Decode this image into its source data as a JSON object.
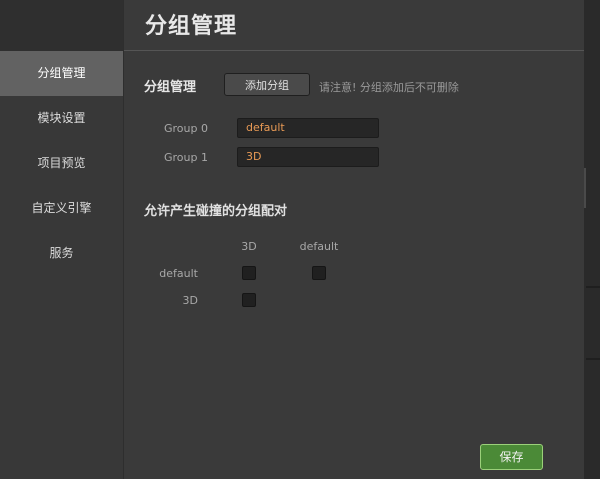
{
  "header": {
    "title": "分组管理"
  },
  "sidebar": {
    "items": [
      {
        "label": "分组管理"
      },
      {
        "label": "模块设置"
      },
      {
        "label": "项目预览"
      },
      {
        "label": "自定义引擎"
      },
      {
        "label": "服务"
      }
    ],
    "active_index": 0
  },
  "groups_section": {
    "label": "分组管理",
    "add_button": "添加分组",
    "notice": "请注意! 分组添加后不可删除",
    "groups": [
      {
        "label": "Group 0",
        "value": "default"
      },
      {
        "label": "Group 1",
        "value": "3D"
      }
    ]
  },
  "collision": {
    "title": "允许产生碰撞的分组配对",
    "columns": [
      "3D",
      "default"
    ],
    "rows": [
      "default",
      "3D"
    ],
    "checked": [
      [
        false,
        false
      ],
      [
        false
      ]
    ]
  },
  "footer": {
    "save_button": "保存"
  },
  "colors": {
    "accent_green": "#4b8a37",
    "input_text": "#e89a55",
    "active_sidebar": "#626262"
  }
}
